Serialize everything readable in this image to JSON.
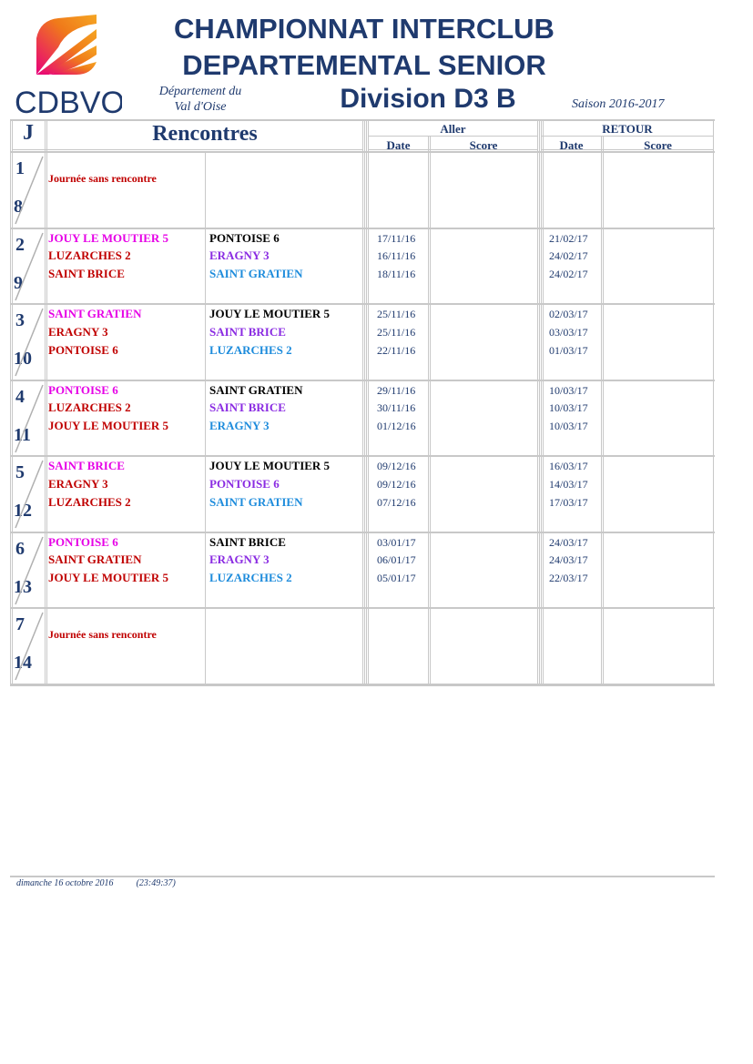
{
  "header": {
    "title_line1": "CHAMPIONNAT INTERCLUB",
    "title_line2": "DEPARTEMENTAL SENIOR",
    "division": "Division D3 B",
    "dept_line1": "Département du",
    "dept_line2": "Val d'Oise",
    "saison": "Saison 2016-2017",
    "logo_text": "CDBVO"
  },
  "table": {
    "col_j": "J",
    "col_rencontres": "Rencontres",
    "aller": "Aller",
    "retour": "RETOUR",
    "date": "Date",
    "score": "Score",
    "sans_rencontre": "Journée sans rencontre"
  },
  "colors": {
    "navy": "#1f3a6e",
    "magenta": "#e600e6",
    "red": "#c00000",
    "black": "#000000",
    "purple": "#8a2be2",
    "blue": "#1e8cdc"
  },
  "rounds": [
    {
      "a": "1",
      "b": "8",
      "empty": true,
      "matches": []
    },
    {
      "a": "2",
      "b": "9",
      "empty": false,
      "matches": [
        {
          "home": "JOUY LE MOUTIER 5",
          "home_color": "magenta",
          "away": "PONTOISE 6",
          "away_color": "black",
          "aller": "17/11/16",
          "retour": "21/02/17"
        },
        {
          "home": "LUZARCHES 2",
          "home_color": "red",
          "away": "ERAGNY 3",
          "away_color": "purple",
          "aller": "16/11/16",
          "retour": "24/02/17"
        },
        {
          "home": "SAINT BRICE",
          "home_color": "red",
          "away": "SAINT GRATIEN",
          "away_color": "blue",
          "aller": "18/11/16",
          "retour": "24/02/17"
        }
      ]
    },
    {
      "a": "3",
      "b": "10",
      "empty": false,
      "matches": [
        {
          "home": "SAINT GRATIEN",
          "home_color": "magenta",
          "away": "JOUY LE MOUTIER 5",
          "away_color": "black",
          "aller": "25/11/16",
          "retour": "02/03/17"
        },
        {
          "home": "ERAGNY 3",
          "home_color": "red",
          "away": "SAINT BRICE",
          "away_color": "purple",
          "aller": "25/11/16",
          "retour": "03/03/17"
        },
        {
          "home": "PONTOISE 6",
          "home_color": "red",
          "away": "LUZARCHES 2",
          "away_color": "blue",
          "aller": "22/11/16",
          "retour": "01/03/17"
        }
      ]
    },
    {
      "a": "4",
      "b": "11",
      "empty": false,
      "matches": [
        {
          "home": "PONTOISE 6",
          "home_color": "magenta",
          "away": "SAINT GRATIEN",
          "away_color": "black",
          "aller": "29/11/16",
          "retour": "10/03/17"
        },
        {
          "home": "LUZARCHES 2",
          "home_color": "red",
          "away": "SAINT BRICE",
          "away_color": "purple",
          "aller": "30/11/16",
          "retour": "10/03/17"
        },
        {
          "home": "JOUY LE MOUTIER 5",
          "home_color": "red",
          "away": "ERAGNY 3",
          "away_color": "blue",
          "aller": "01/12/16",
          "retour": "10/03/17"
        }
      ]
    },
    {
      "a": "5",
      "b": "12",
      "empty": false,
      "matches": [
        {
          "home": "SAINT BRICE",
          "home_color": "magenta",
          "away": "JOUY LE MOUTIER 5",
          "away_color": "black",
          "aller": "09/12/16",
          "retour": "16/03/17"
        },
        {
          "home": "ERAGNY 3",
          "home_color": "red",
          "away": "PONTOISE 6",
          "away_color": "purple",
          "aller": "09/12/16",
          "retour": "14/03/17"
        },
        {
          "home": "LUZARCHES 2",
          "home_color": "red",
          "away": "SAINT GRATIEN",
          "away_color": "blue",
          "aller": "07/12/16",
          "retour": "17/03/17"
        }
      ]
    },
    {
      "a": "6",
      "b": "13",
      "empty": false,
      "matches": [
        {
          "home": "PONTOISE 6",
          "home_color": "magenta",
          "away": "SAINT BRICE",
          "away_color": "black",
          "aller": "03/01/17",
          "retour": "24/03/17"
        },
        {
          "home": "SAINT GRATIEN",
          "home_color": "red",
          "away": "ERAGNY 3",
          "away_color": "purple",
          "aller": "06/01/17",
          "retour": "24/03/17"
        },
        {
          "home": "JOUY LE MOUTIER 5",
          "home_color": "red",
          "away": "LUZARCHES 2",
          "away_color": "blue",
          "aller": "05/01/17",
          "retour": "22/03/17"
        }
      ]
    },
    {
      "a": "7",
      "b": "14",
      "empty": true,
      "matches": []
    }
  ],
  "footer": {
    "date": "dimanche 16 octobre 2016",
    "time": "(23:49:37)"
  }
}
